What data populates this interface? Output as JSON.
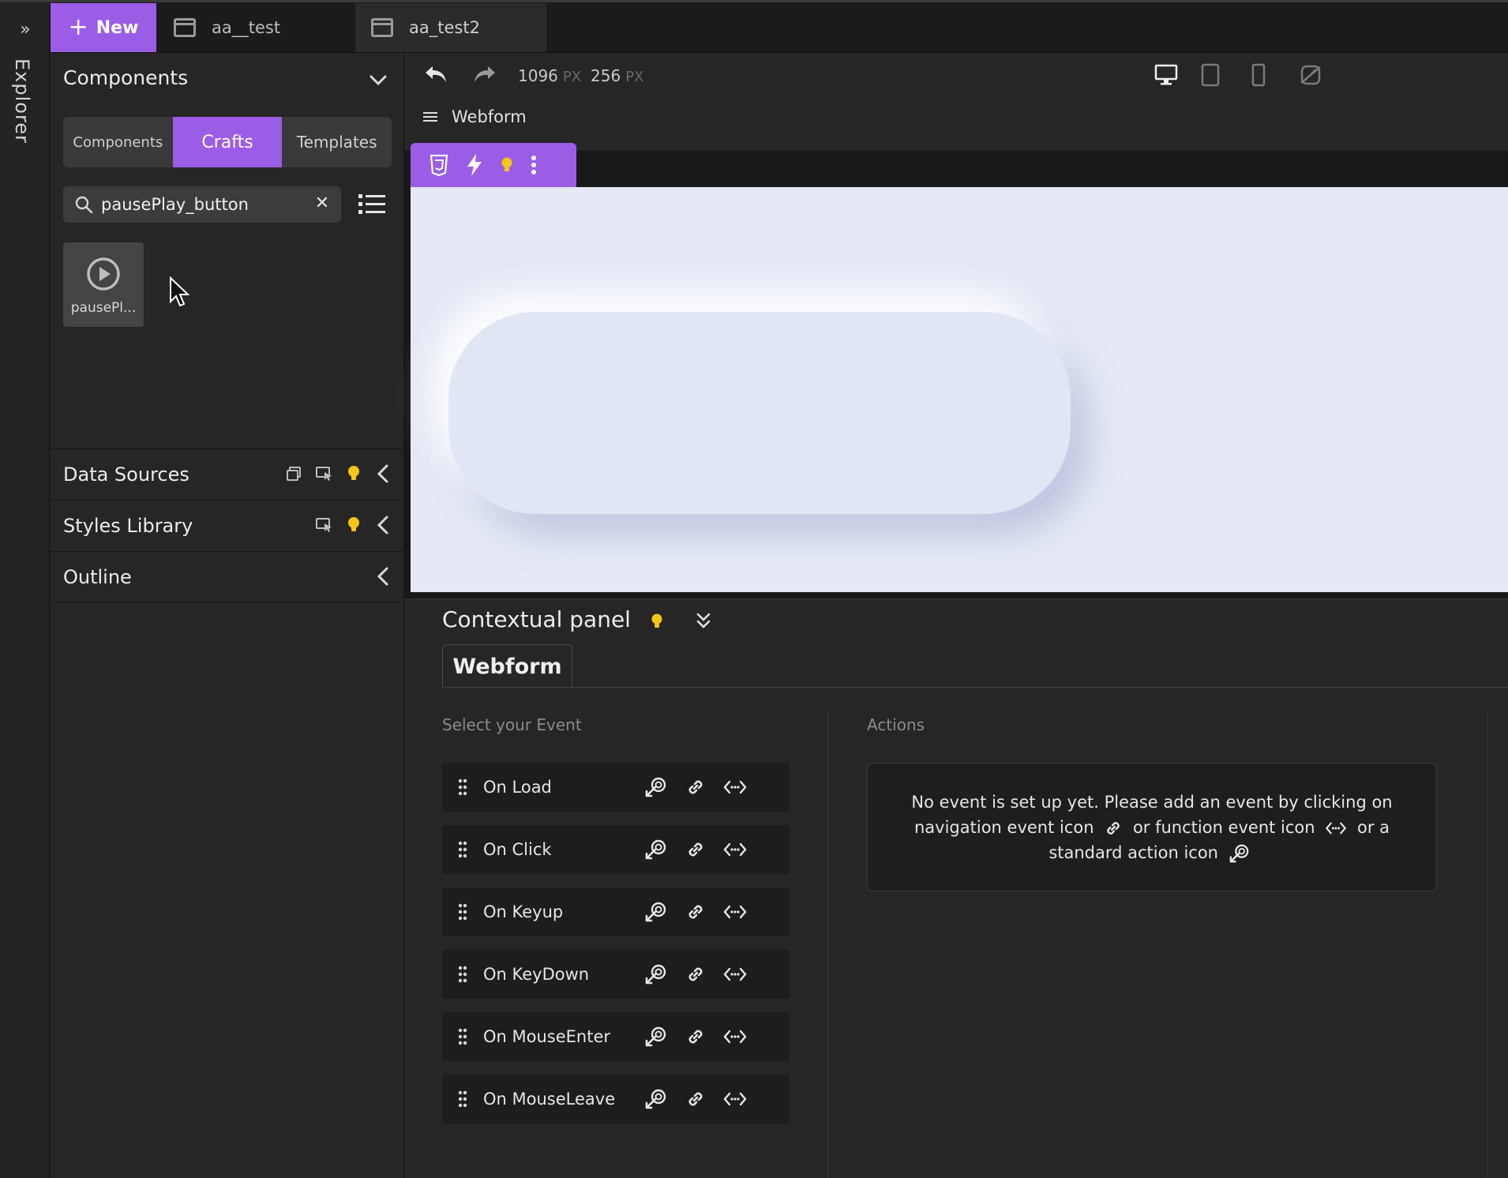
{
  "rail": {
    "label": "Explorer",
    "chevron": "»"
  },
  "tabs": {
    "new_label": "New",
    "items": [
      {
        "label": "aa__test"
      },
      {
        "label": "aa_test2"
      }
    ]
  },
  "components_panel": {
    "title": "Components",
    "segments": [
      "Components",
      "Crafts",
      "Templates"
    ],
    "active_segment": "Crafts",
    "search": {
      "value": "pausePlay_button",
      "placeholder": ""
    },
    "results": [
      {
        "label": "pausePl...",
        "icon": "play-circle-icon"
      }
    ]
  },
  "accordions": {
    "data_sources": "Data Sources",
    "styles_library": "Styles Library",
    "outline": "Outline"
  },
  "toolbar": {
    "width_value": "1096",
    "height_value": "256",
    "unit": "PX",
    "breadcrumb": "Webform"
  },
  "contextual": {
    "title": "Contextual panel",
    "tab": "Webform",
    "events_label": "Select your Event",
    "actions_label": "Actions",
    "events": [
      "On Load",
      "On Click",
      "On Keyup",
      "On KeyDown",
      "On MouseEnter",
      "On MouseLeave"
    ],
    "empty_message": {
      "part1": "No event is set up yet. Please add an event by clicking on navigation event icon",
      "part2": "or function event icon",
      "part3": "or a standard action icon"
    }
  },
  "colors": {
    "accent": "#9b5de5",
    "bulb": "#f5c518",
    "canvas": "#e4e9f4"
  }
}
